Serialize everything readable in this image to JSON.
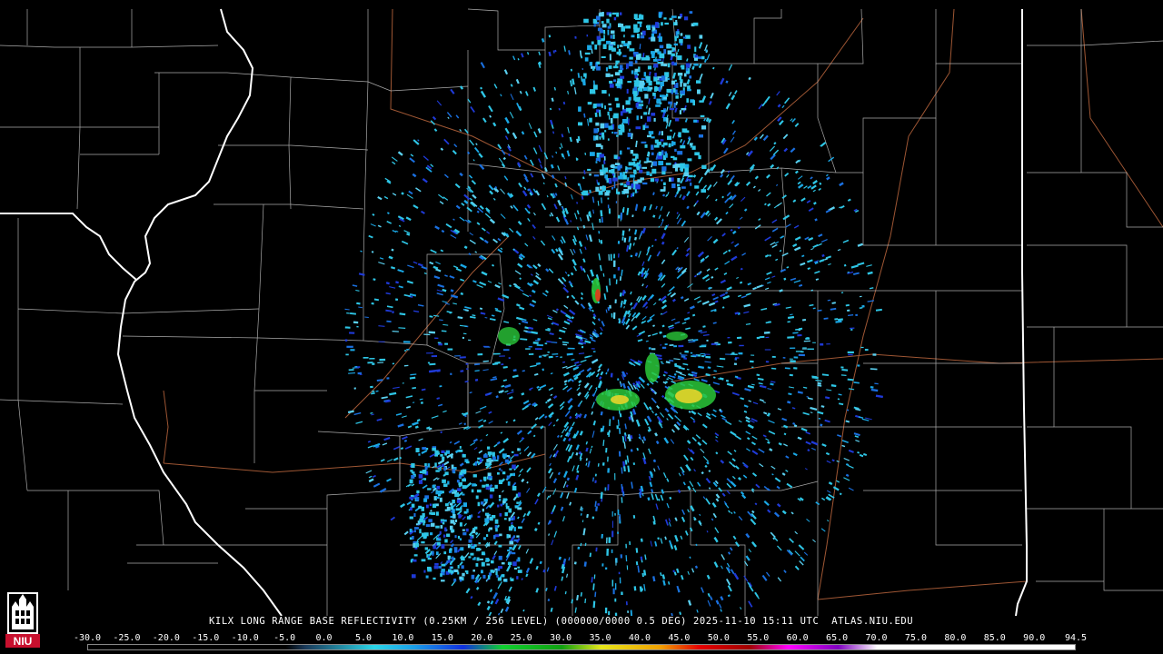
{
  "map": {
    "radar_site": "KILX",
    "product": "LONG RANGE BASE REFLECTIVITY (0.25KM / 256 LEVEL)",
    "caption": "KILX LONG RANGE BASE REFLECTIVITY (0.25KM / 256 LEVEL) (000000/0000 0.5 DEG) 2025-11-10 15:11 UTC  ATLAS.NIU.EDU"
  },
  "scale": {
    "labels": [
      "-30.0",
      "-25.0",
      "-20.0",
      "-15.0",
      "-10.0",
      "-5.0",
      "0.0",
      "5.0",
      "10.0",
      "15.0",
      "20.0",
      "25.0",
      "30.0",
      "35.0",
      "40.0",
      "45.0",
      "50.0",
      "55.0",
      "60.0",
      "65.0",
      "70.0",
      "75.0",
      "80.0",
      "85.0",
      "90.0",
      "94.5"
    ],
    "unit_range": [
      -30.0,
      94.5
    ],
    "colors": {
      "background": "#000000",
      "county_border": "#bfbfbf",
      "state_border": "#ffffff",
      "highway": "#b0603a"
    }
  },
  "logo": {
    "text": "NIU",
    "color": "#c8102e",
    "icon": "niu-castle-icon"
  }
}
